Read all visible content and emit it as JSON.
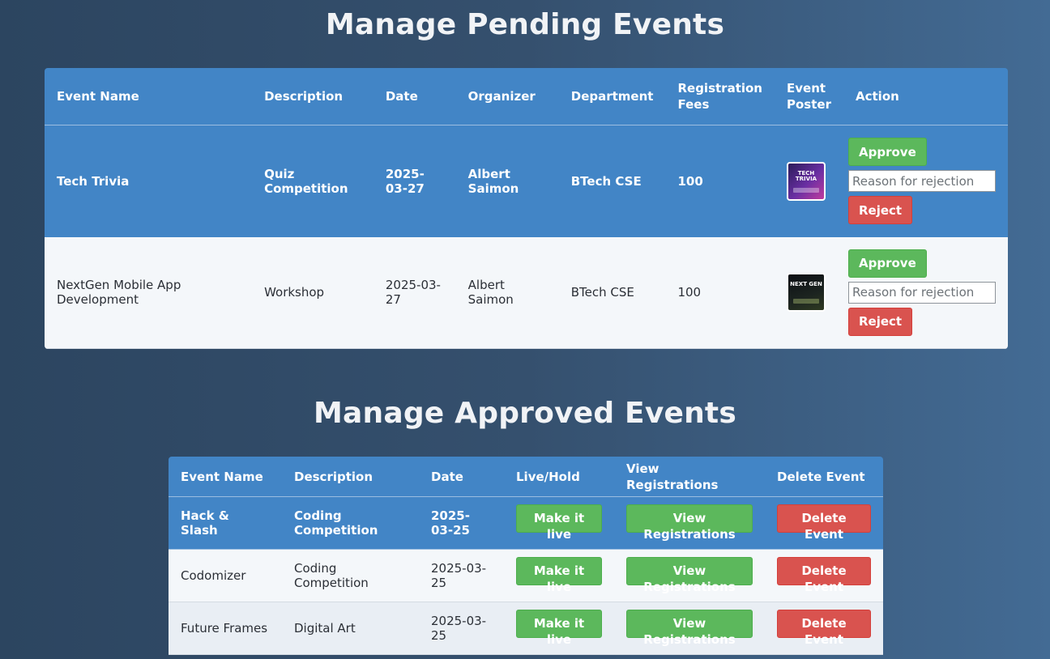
{
  "pending": {
    "title": "Manage Pending Events",
    "headers": {
      "name": "Event Name",
      "description": "Description",
      "date": "Date",
      "organizer": "Organizer",
      "department": "Department",
      "fees": "Registration Fees",
      "poster": "Event Poster",
      "action": "Action"
    },
    "rows": [
      {
        "name": "Tech Trivia",
        "description": "Quiz Competition",
        "date": "2025-03-27",
        "organizer": "Albert Saimon",
        "department": "BTech CSE",
        "fees": "100",
        "poster_text": "TECH TRIVIA",
        "approve_label": "Approve",
        "reason_placeholder": "Reason for rejection",
        "reject_label": "Reject"
      },
      {
        "name": "NextGen Mobile App Development",
        "description": "Workshop",
        "date": "2025-03-27",
        "organizer": "Albert Saimon",
        "department": "BTech CSE",
        "fees": "100",
        "poster_text": "NEXT GEN",
        "approve_label": "Approve",
        "reason_placeholder": "Reason for rejection",
        "reject_label": "Reject"
      }
    ]
  },
  "approved": {
    "title": "Manage Approved Events",
    "headers": {
      "name": "Event Name",
      "description": "Description",
      "date": "Date",
      "live": "Live/Hold",
      "registrations": "View Registrations",
      "delete": "Delete Event"
    },
    "rows": [
      {
        "name": "Hack & Slash",
        "description": "Coding Competition",
        "date": "2025-03-25",
        "live_label": "Make it live",
        "registrations_label": "View Registrations",
        "delete_label": "Delete Event"
      },
      {
        "name": "Codomizer",
        "description": "Coding Competition",
        "date": "2025-03-25",
        "live_label": "Make it live",
        "registrations_label": "View Registrations",
        "delete_label": "Delete Event"
      },
      {
        "name": "Future Frames",
        "description": "Digital Art",
        "date": "2025-03-25",
        "live_label": "Make it live",
        "registrations_label": "View Registrations",
        "delete_label": "Delete Event"
      }
    ]
  },
  "colors": {
    "header_blue": "#4285c6",
    "approve_green": "#5cb85c",
    "reject_red": "#d9534f"
  }
}
